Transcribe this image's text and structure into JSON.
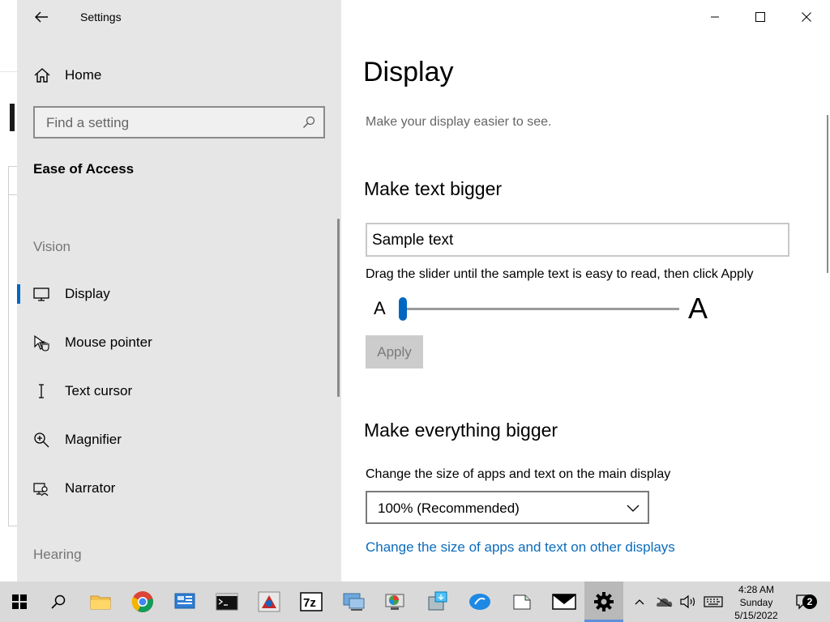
{
  "window": {
    "title": "Settings"
  },
  "sidebar": {
    "home_label": "Home",
    "search_placeholder": "Find a setting",
    "group_title": "Ease of Access",
    "vision_label": "Vision",
    "hearing_label": "Hearing",
    "items": [
      {
        "label": "Display",
        "icon": "monitor-icon",
        "selected": true
      },
      {
        "label": "Mouse pointer",
        "icon": "mouse-pointer-icon",
        "selected": false
      },
      {
        "label": "Text cursor",
        "icon": "text-cursor-icon",
        "selected": false
      },
      {
        "label": "Magnifier",
        "icon": "magnifier-icon",
        "selected": false
      },
      {
        "label": "Narrator",
        "icon": "narrator-icon",
        "selected": false
      }
    ]
  },
  "main": {
    "title": "Display",
    "subtitle": "Make your display easier to see.",
    "text_bigger_heading": "Make text bigger",
    "sample_text": "Sample text",
    "drag_hint": "Drag the slider until the sample text is easy to read, then click Apply",
    "slider_small_label": "A",
    "slider_large_label": "A",
    "slider_value_fraction": 0.0,
    "apply_label": "Apply",
    "everything_bigger_heading": "Make everything bigger",
    "size_hint": "Change the size of apps and text on the main display",
    "scale_value": "100% (Recommended)",
    "other_displays_link": "Change the size of apps and text on other displays"
  },
  "taskbar": {
    "apps": [
      "start-icon",
      "search-icon",
      "file-explorer-icon",
      "chrome-icon",
      "control-panel-icon",
      "command-prompt-icon",
      "java-app-icon",
      "7zip-icon",
      "network-icon",
      "system-info-icon",
      "installer-icon",
      "feedback-icon",
      "notes-icon",
      "mail-icon",
      "settings-icon"
    ],
    "active_app": "settings-icon",
    "time": "4:28 AM",
    "day": "Sunday",
    "date": "5/15/2022",
    "notification_count": "2"
  },
  "colors": {
    "accent": "#0067c0",
    "link": "#0b6cbd",
    "sidebar_bg": "#e6e6e6",
    "taskbar_bg": "#d9d9d9"
  }
}
